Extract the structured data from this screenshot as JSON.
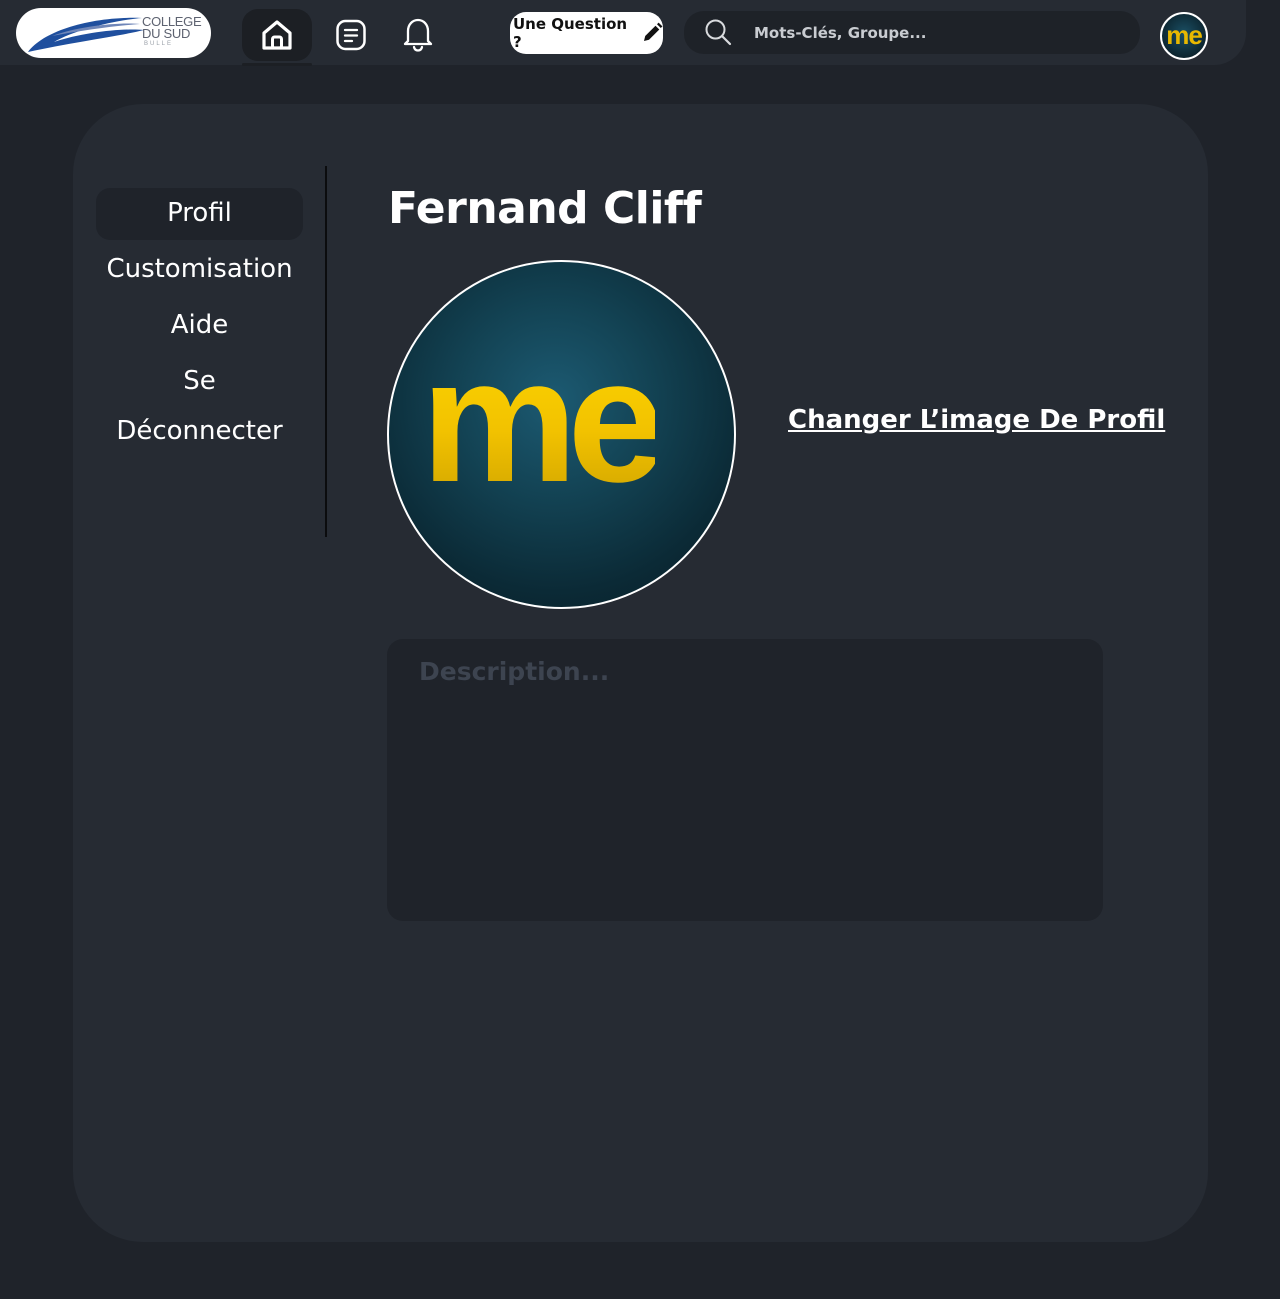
{
  "header": {
    "logo": {
      "line1": "COLLEGE",
      "line2": "DU SUD",
      "line3": "BULLE"
    },
    "nav_icons": [
      "home-icon",
      "list-icon",
      "bell-icon"
    ],
    "ask_button_label": "Une Question ?",
    "search_placeholder": "Mots-Clés, Groupe...",
    "avatar_text": "me"
  },
  "sidebar": {
    "items": [
      {
        "label": "Profil",
        "active": true
      },
      {
        "label": "Customisation",
        "active": false
      },
      {
        "label": "Aide",
        "active": false
      },
      {
        "label": "Se Déconnecter",
        "active": false
      }
    ]
  },
  "profile": {
    "name": "Fernand Cliff",
    "avatar_text": "me",
    "change_image_label": "Changer L’image De Profil",
    "description_placeholder": "Description..."
  },
  "colors": {
    "page_bg": "#1f232a",
    "panel_bg": "#262b33",
    "accent_yellow": "#f2c200",
    "logo_blue": "#1f4f9e"
  }
}
